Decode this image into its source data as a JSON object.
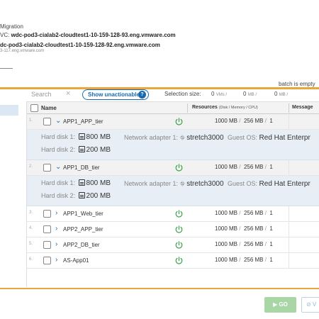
{
  "header": {
    "migration_label": "Migration",
    "vc_prefix": "VC: ",
    "vc_host": "wdc-pod3-cialab2-cloudtest1-10-159-128-93.eng.vmware.com",
    "dc_host": "dc-pod3-cialab2-cloudtest1-10-159-128-92.eng.vmware.com",
    "sub_host": "3-117.eng.vmware.com",
    "batch_status": "batch is empty"
  },
  "toolbar": {
    "search_placeholder": "Search",
    "show_unactionable_label": "Show unactionable",
    "unactionable_count": "?",
    "selection_size_label": "Selection size:",
    "vms_value": "0",
    "vms_unit": "VMs /",
    "mem_value": "0",
    "mem_unit": "MB /",
    "cpu_value": "0",
    "cpu_unit": "MB /"
  },
  "grid": {
    "columns": {
      "name": "Name",
      "resources": "Resources",
      "resources_sub": "(Disk / Memory / CPU)",
      "message": "Message"
    },
    "rows": [
      {
        "num": "1.",
        "name": "APP1_APP_tier",
        "expanded": true,
        "disk": "1000 MB",
        "memory": "256 MB",
        "cpu": "1",
        "details": {
          "hard_disk_1_label": "Hard disk 1:",
          "hard_disk_1_value": "800 MB",
          "hard_disk_2_label": "Hard disk 2:",
          "hard_disk_2_value": "200 MB",
          "network_label": "Network adapter 1:",
          "network_value": "stretch3000",
          "guest_os_label": "Guest OS:",
          "guest_os_value": "Red Hat Enterpr"
        }
      },
      {
        "num": "2.",
        "name": "APP1_DB_tier",
        "expanded": true,
        "disk": "1000 MB",
        "memory": "256 MB",
        "cpu": "1",
        "details": {
          "hard_disk_1_label": "Hard disk 1:",
          "hard_disk_1_value": "800 MB",
          "hard_disk_2_label": "Hard disk 2:",
          "hard_disk_2_value": "200 MB",
          "network_label": "Network adapter 1:",
          "network_value": "stretch3000",
          "guest_os_label": "Guest OS:",
          "guest_os_value": "Red Hat Enterpr"
        }
      },
      {
        "num": "3.",
        "name": "APP1_Web_tier",
        "expanded": false,
        "disk": "1000 MB",
        "memory": "256 MB",
        "cpu": "1"
      },
      {
        "num": "4.",
        "name": "APP2_APP_tier",
        "expanded": false,
        "disk": "1000 MB",
        "memory": "256 MB",
        "cpu": "1"
      },
      {
        "num": "5.",
        "name": "APP2_DB_tier",
        "expanded": false,
        "disk": "1000 MB",
        "memory": "256 MB",
        "cpu": "1"
      },
      {
        "num": "6.",
        "name": "AS-App01",
        "expanded": false,
        "disk": "1000 MB",
        "memory": "256 MB",
        "cpu": "1"
      }
    ]
  },
  "footer": {
    "go_label": "▶ GO",
    "validate_label": "⊘ V"
  },
  "colors": {
    "accent_orange": "#e8a63c",
    "link_blue": "#1a6ab0",
    "power_green": "#3aa34a",
    "go_green": "#a8d6a5"
  }
}
